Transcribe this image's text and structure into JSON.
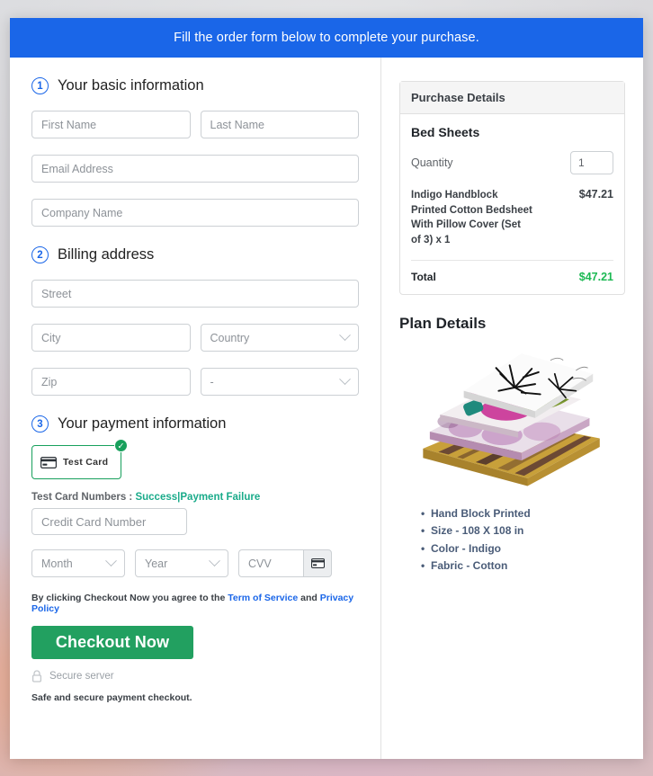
{
  "banner": {
    "text": "Fill the order form below to complete your purchase."
  },
  "steps": [
    {
      "num": "1",
      "title": "Your basic information"
    },
    {
      "num": "2",
      "title": "Billing address"
    },
    {
      "num": "3",
      "title": "Your payment information"
    }
  ],
  "basic_info": {
    "first_name_placeholder": "First Name",
    "last_name_placeholder": "Last Name",
    "email_placeholder": "Email Address",
    "company_placeholder": "Company Name"
  },
  "billing": {
    "street_placeholder": "Street",
    "city_placeholder": "City",
    "country_placeholder": "Country",
    "zip_placeholder": "Zip",
    "state_placeholder": "-"
  },
  "payment": {
    "tile_label": "Test Card",
    "tile_check_icon": "check-circle-icon",
    "card_icon": "credit-card-icon",
    "hint_prefix": "Test Card Numbers :",
    "hint_success": "Success",
    "hint_separator": "|",
    "hint_failure": "Payment Failure",
    "card_number_placeholder": "Credit Card Number",
    "month_placeholder": "Month",
    "year_placeholder": "Year",
    "cvv_placeholder": "CVV",
    "cvv_icon": "credit-card-icon"
  },
  "footer": {
    "terms_prefix": "By clicking Checkout Now you agree to the",
    "terms_link": "Term of Service",
    "terms_and": "and",
    "privacy_link": "Privacy Policy",
    "checkout_label": "Checkout Now",
    "secure_icon": "lock-icon",
    "secure_text": "Secure server",
    "safe_text": "Safe and secure payment checkout."
  },
  "purchase": {
    "panel_title": "Purchase Details",
    "product_name": "Bed Sheets",
    "quantity_label": "Quantity",
    "quantity_value": "1",
    "line_item_desc": "Indigo Handblock Printed Cotton Bedsheet With Pillow Cover (Set of 3) x 1",
    "line_item_price": "$47.21",
    "total_label": "Total",
    "total_value": "$47.21"
  },
  "plan": {
    "title": "Plan Details",
    "image_name": "bed-sheets-product-photo",
    "bullets": [
      "Hand Block Printed",
      "Size - 108 X 108 in",
      "Color - Indigo",
      "Fabric - Cotton"
    ]
  },
  "colors": {
    "banner_blue": "#1a66e8",
    "accent_green": "#22a060",
    "tile_green": "#18a05c",
    "link_teal": "#1aab8a",
    "total_green": "#1db954",
    "bullet_slate": "#4a5c78"
  }
}
